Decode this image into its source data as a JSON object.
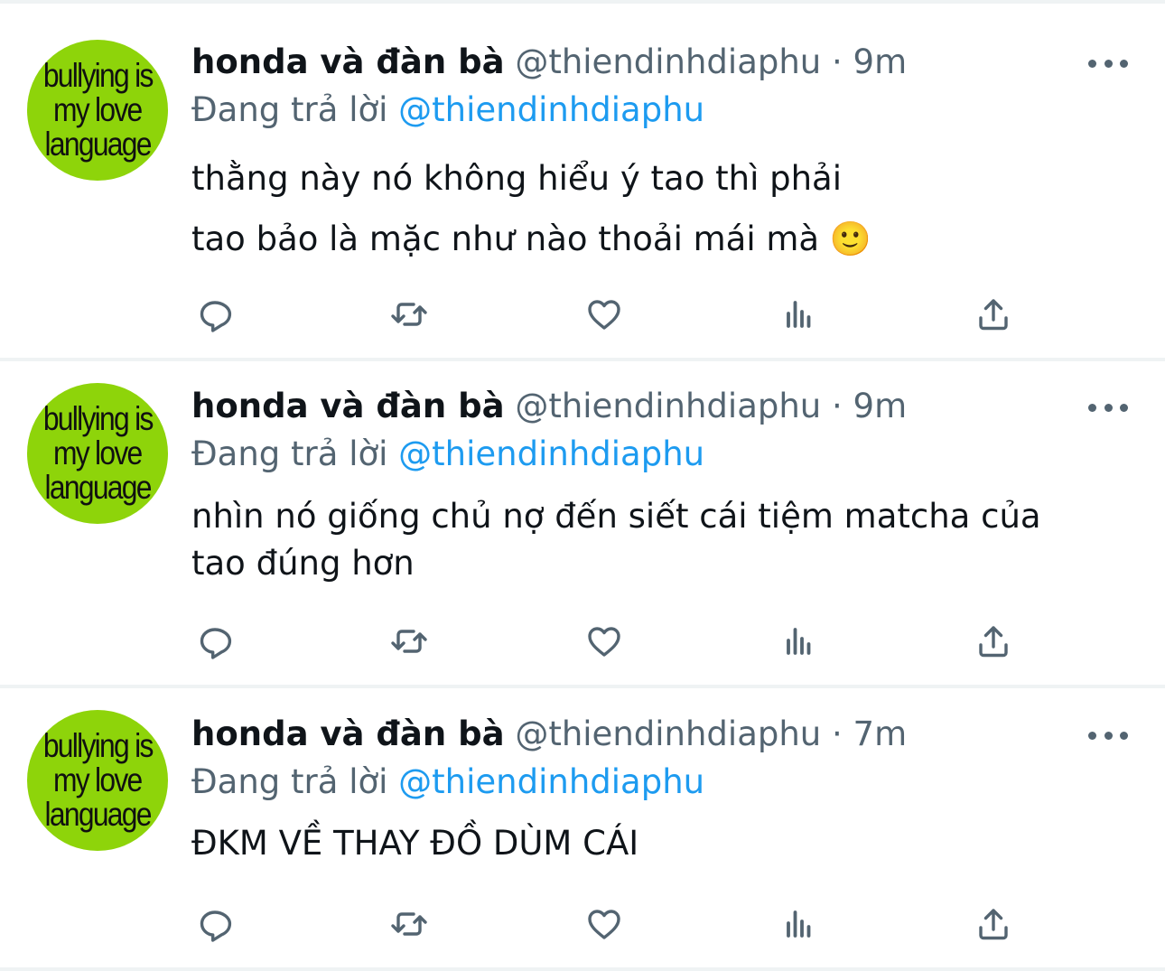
{
  "colors": {
    "text_primary": "#0f1419",
    "text_secondary": "#536471",
    "mention": "#1d9bf0",
    "avatar_bg": "#8ed40a",
    "divider": "#eff3f4"
  },
  "tweets": [
    {
      "avatar": {
        "lines": [
          "bullying is",
          "my love",
          "language"
        ]
      },
      "display_name": "honda và đàn bà",
      "meta": "@thiendinhdiaphu · 9m",
      "reply_label": "Đang trả lời",
      "reply_mention": "@thiendinhdiaphu",
      "text_lines": [
        "thằng này nó không hiểu ý tao thì phải",
        "tao bảo là mặc như nào thoải mái mà 🙂"
      ],
      "actions": [
        "reply-icon",
        "retweet-icon",
        "like-icon",
        "views-icon",
        "share-icon"
      ]
    },
    {
      "avatar": {
        "lines": [
          "bullying is",
          "my love",
          "language"
        ]
      },
      "display_name": "honda và đàn bà",
      "meta": "@thiendinhdiaphu · 9m",
      "reply_label": "Đang trả lời",
      "reply_mention": "@thiendinhdiaphu",
      "text_lines": [
        "nhìn nó giống chủ nợ đến siết cái tiệm matcha của",
        "tao đúng hơn"
      ],
      "actions": [
        "reply-icon",
        "retweet-icon",
        "like-icon",
        "views-icon",
        "share-icon"
      ]
    },
    {
      "avatar": {
        "lines": [
          "bullying is",
          "my love",
          "language"
        ]
      },
      "display_name": "honda và đàn bà",
      "meta": "@thiendinhdiaphu · 7m",
      "reply_label": "Đang trả lời",
      "reply_mention": "@thiendinhdiaphu",
      "text_lines": [
        "ĐKM VỀ THAY ĐỒ DÙM CÁI"
      ],
      "actions": [
        "reply-icon",
        "retweet-icon",
        "like-icon",
        "views-icon",
        "share-icon"
      ]
    }
  ]
}
